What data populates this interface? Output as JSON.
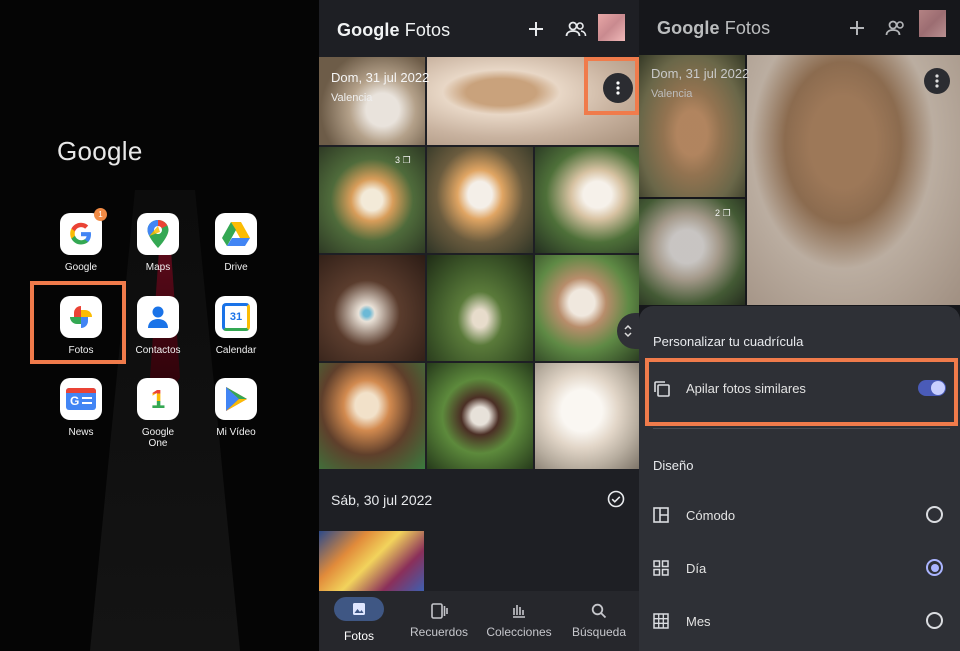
{
  "panel_home": {
    "folder_title": "Google",
    "apps": [
      {
        "label": "Google",
        "icon": "google-g-icon",
        "badge": "1"
      },
      {
        "label": "Maps",
        "icon": "maps-pin-icon"
      },
      {
        "label": "Drive",
        "icon": "drive-triangle-icon"
      },
      {
        "label": "Fotos",
        "icon": "photos-pinwheel-icon"
      },
      {
        "label": "Contactos",
        "icon": "contacts-person-icon"
      },
      {
        "label": "Calendar",
        "icon": "calendar-icon",
        "icon_text": "31"
      },
      {
        "label": "News",
        "icon": "news-icon",
        "icon_text": "G"
      },
      {
        "label": "Google\nOne",
        "icon": "google-one-icon",
        "icon_text": "1"
      },
      {
        "label": "Mi Vídeo",
        "icon": "play-icon"
      }
    ],
    "highlight_color": "#f07b4b"
  },
  "panel_photos": {
    "brand_main": "Google",
    "brand_sub": "Fotos",
    "section1": {
      "date": "Dom, 31 jul 2022",
      "location": "Valencia"
    },
    "stack_count": "3",
    "section2": {
      "date": "Sáb, 30 jul 2022"
    },
    "nav": [
      {
        "label": "Fotos",
        "icon": "photo-icon",
        "active": true
      },
      {
        "label": "Recuerdos",
        "icon": "memories-icon"
      },
      {
        "label": "Colecciones",
        "icon": "collections-icon"
      },
      {
        "label": "Búsqueda",
        "icon": "search-icon"
      }
    ]
  },
  "panel_settings": {
    "brand_main": "Google",
    "brand_sub": "Fotos",
    "date": "Dom, 31 jul 2022",
    "location": "Valencia",
    "stack_count": "2",
    "sheet_title": "Personalizar tu cuadrícula",
    "stack_option": {
      "label": "Apilar fotos similares",
      "enabled": true
    },
    "layout_title": "Diseño",
    "layouts": [
      {
        "label": "Cómodo",
        "icon": "comfortable-layout-icon",
        "selected": false
      },
      {
        "label": "Día",
        "icon": "day-layout-icon",
        "selected": true
      },
      {
        "label": "Mes",
        "icon": "month-layout-icon",
        "selected": false
      }
    ],
    "accent": "#aab4ff"
  }
}
